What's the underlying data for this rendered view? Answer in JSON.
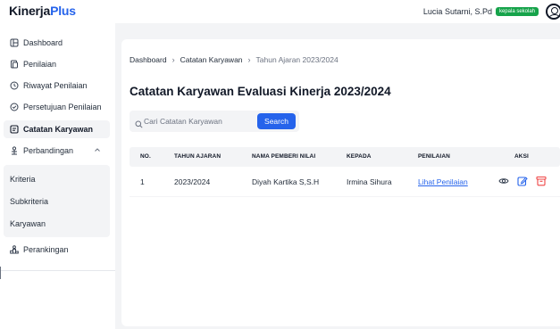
{
  "app": {
    "logo_part1": "Kinerja",
    "logo_part2": "Plus",
    "brand_color": "#2563eb"
  },
  "user": {
    "name": "Lucia Sutarni, S.Pd",
    "role_badge": "kepala sekolah",
    "icon": "user-circle-icon"
  },
  "sidebar": {
    "items": [
      {
        "label": "Dashboard",
        "icon": "dashboard-icon"
      },
      {
        "label": "Penilaian",
        "icon": "document-icon"
      },
      {
        "label": "Riwayat Penilaian",
        "icon": "history-icon"
      },
      {
        "label": "Persetujuan Penilaian",
        "icon": "check-circle-icon"
      },
      {
        "label": "Catatan Karyawan",
        "icon": "note-icon",
        "active": true
      },
      {
        "label": "Perbandingan",
        "icon": "scale-icon",
        "expanded": true
      }
    ],
    "subitems": [
      {
        "label": "Kriteria"
      },
      {
        "label": "Subkriteria"
      },
      {
        "label": "Karyawan"
      }
    ],
    "ranking": {
      "label": "Perankingan",
      "icon": "ranking-icon"
    }
  },
  "breadcrumb": {
    "home": "Dashboard",
    "section": "Catatan Karyawan",
    "current": "Tahun Ajaran 2023/2024"
  },
  "page": {
    "title": "Catatan Karyawan Evaluasi Kinerja 2023/2024"
  },
  "search": {
    "placeholder": "Cari Catatan Karyawan",
    "value": "",
    "button_label": "Search"
  },
  "table": {
    "columns": [
      "NO.",
      "TAHUN AJARAN",
      "NAMA PEMBERI NILAI",
      "KEPADA",
      "PENILAIAN",
      "AKSI"
    ],
    "rows": [
      {
        "no": "1",
        "tahun_ajaran": "2023/2024",
        "pemberi_nilai": "Diyah Kartika S,S.H",
        "kepada": "Irmina Sihura",
        "penilaian_link": "Lihat Penilaian",
        "actions": [
          "eye-icon",
          "edit-icon",
          "delete-icon"
        ]
      }
    ]
  },
  "colors": {
    "accent": "#2563eb",
    "badge": "#16a34a",
    "danger": "#ef4444"
  }
}
